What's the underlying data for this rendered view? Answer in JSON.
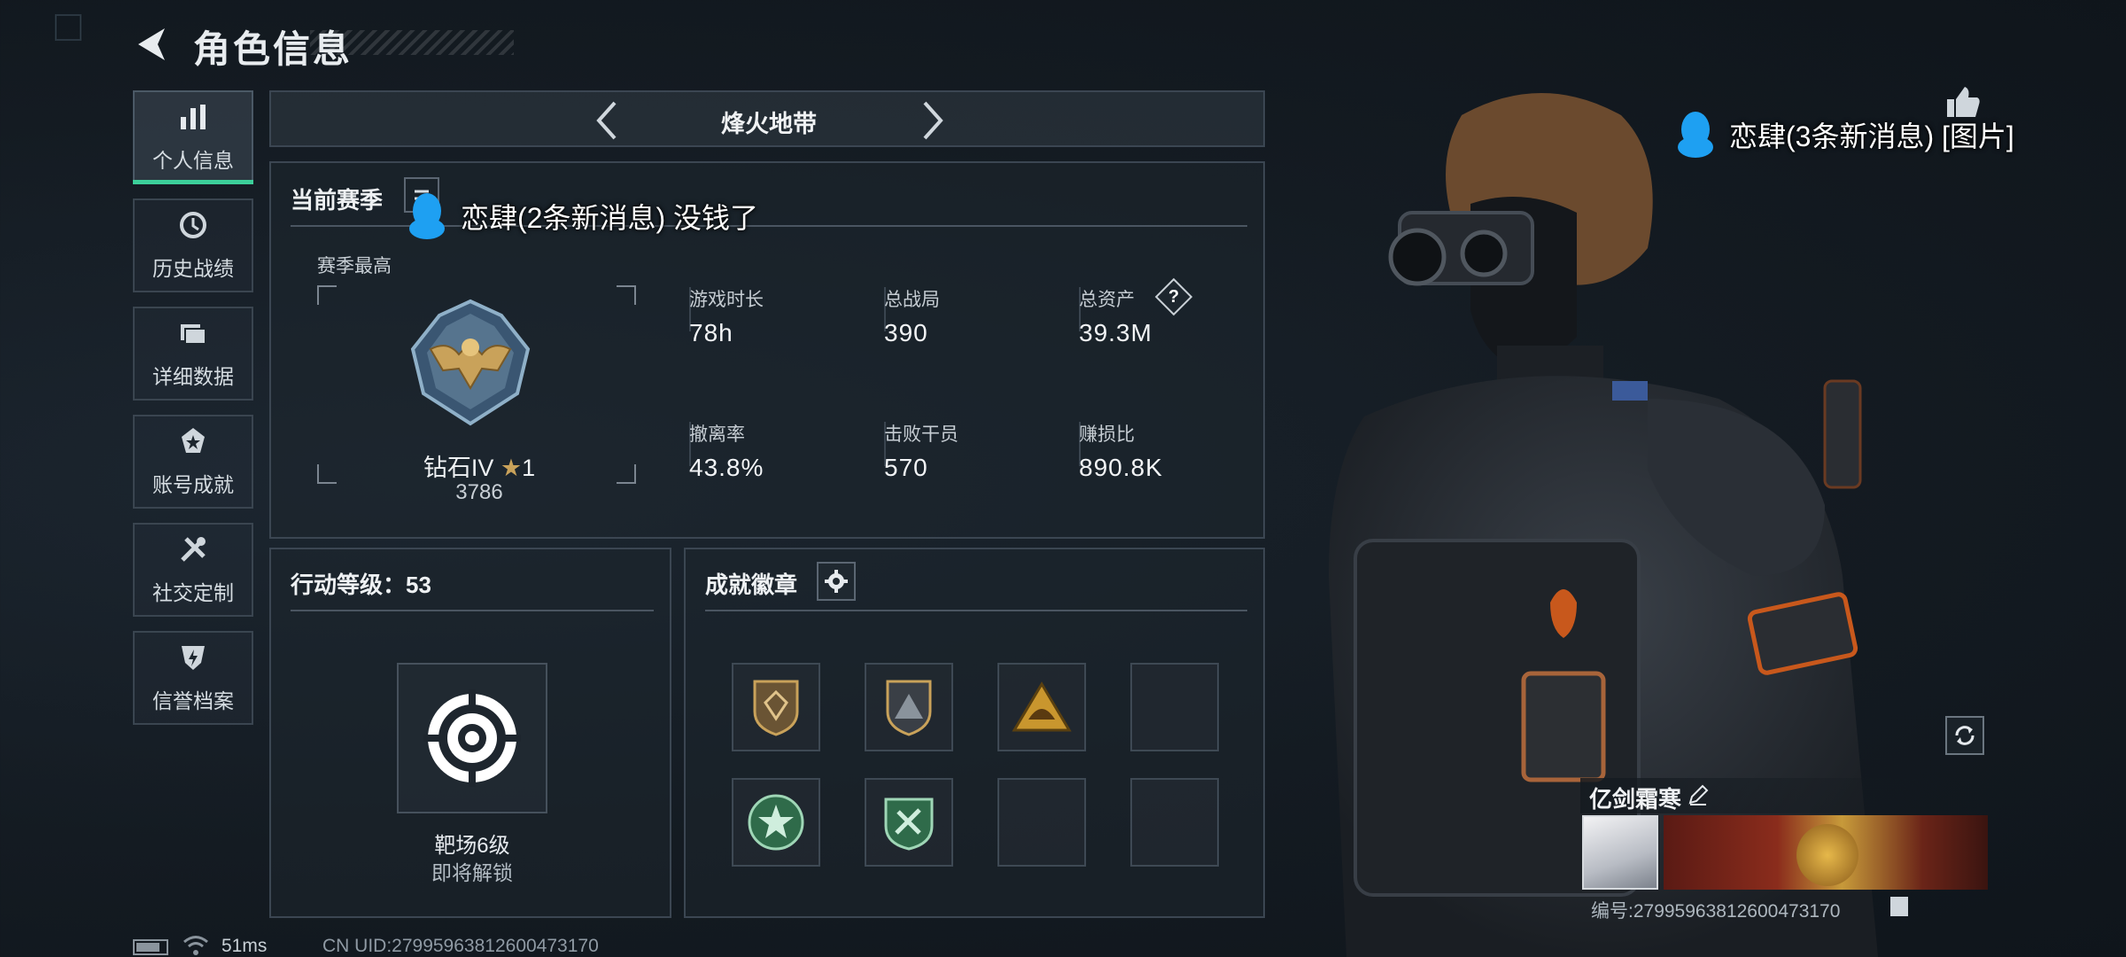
{
  "header": {
    "title": "角色信息"
  },
  "sidebar": {
    "items": [
      {
        "label": "个人信息",
        "icon": "bar-chart-icon"
      },
      {
        "label": "历史战绩",
        "icon": "history-icon"
      },
      {
        "label": "详细数据",
        "icon": "folder-icon"
      },
      {
        "label": "账号成就",
        "icon": "achievement-icon"
      },
      {
        "label": "社交定制",
        "icon": "tools-icon"
      },
      {
        "label": "信誉档案",
        "icon": "shield-icon"
      }
    ]
  },
  "season_nav": {
    "name": "烽火地带"
  },
  "current_season": {
    "title": "当前赛季",
    "best_label": "赛季最高",
    "rank_name": "钻石IV",
    "rank_stars": "1",
    "rank_score": "3786",
    "stats": [
      {
        "label": "游戏时长",
        "value": "78h"
      },
      {
        "label": "总战局",
        "value": "390"
      },
      {
        "label": "总资产",
        "value": "39.3M"
      },
      {
        "label": "撤离率",
        "value": "43.8%"
      },
      {
        "label": "击败干员",
        "value": "570"
      },
      {
        "label": "赚损比",
        "value": "890.8K"
      }
    ],
    "help_glyph": "?"
  },
  "action_level": {
    "title": "行动等级：53",
    "item_name": "靶场6级",
    "item_status": "即将解锁"
  },
  "badges": {
    "title": "成就徽章"
  },
  "profile": {
    "name": "亿剑霜寒",
    "id_text": "编号:2799596381260047317​0"
  },
  "notifications": [
    {
      "text": "恋肆(2条新消息) 没钱了"
    },
    {
      "text": "恋肆(3条新消息) [图片]"
    }
  ],
  "footer": {
    "ping": "51ms",
    "uid": "CN UID:2799596381260047317​0"
  },
  "colors": {
    "accent": "#3ccf9a",
    "panel_border": "#3b4652"
  }
}
